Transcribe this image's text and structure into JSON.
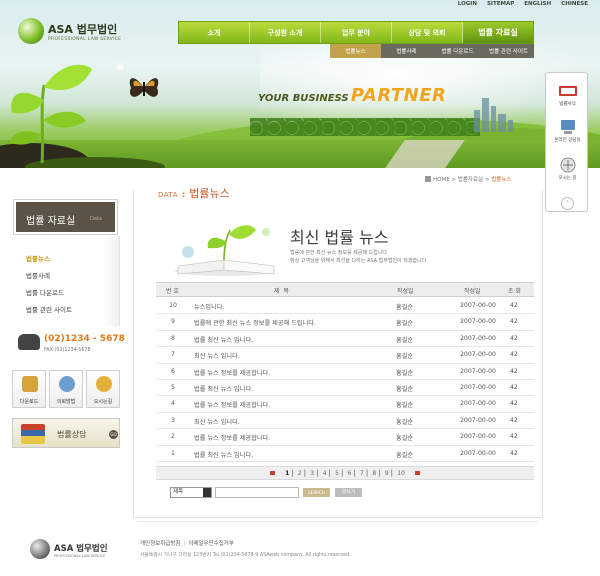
{
  "brand": {
    "name": "ASA 법무법인",
    "tagline": "PROFESSIONAL LAW SERVICE"
  },
  "util_nav": [
    "LOGIN",
    "SITEMAP",
    "ENGLISH",
    "CHINESE"
  ],
  "gnb": [
    "소개",
    "구성원 소개",
    "업무 분야",
    "상담 및 의뢰",
    "법률 자료실"
  ],
  "lnb": [
    "법률뉴스",
    "법률사례",
    "법률 다운로드",
    "법률 관련 사이트"
  ],
  "banner": {
    "slogan_a": "YOUR BUSINESS",
    "slogan_b": "PARTNER"
  },
  "quick_menu": [
    "법률서식",
    "온라인 상담실",
    "오시는 길"
  ],
  "sidebar": {
    "title": "법률 자료실",
    "title_en": "Data",
    "items": [
      "법률뉴스",
      "법률사례",
      "법률 다운로드",
      "법률 관련 사이트"
    ],
    "phone": "(02)1234 - 5678",
    "fax": "FAX:(02)1234-5678",
    "icons": [
      "다운로드",
      "의뢰방법",
      "오시는길"
    ],
    "consult": "법률상담"
  },
  "breadcrumb": [
    "HOME",
    "법률자료실",
    "법률뉴스"
  ],
  "heading": {
    "en": "DATA",
    "sep": ":",
    "ko": "법률뉴스"
  },
  "intro": {
    "title": "최신 법률 뉴스",
    "desc1": "법률에 관한 최신 뉴스 정보를 제공해 드립니다.",
    "desc2": "항상 고객님을 위해서 최선을 다하는 ASA 법무법인이 되겠습니다."
  },
  "table": {
    "headers": [
      "번 호",
      "제            목",
      "작성일",
      "작성일",
      "조 회"
    ],
    "rows": [
      {
        "num": "10",
        "title": "뉴스입니다.",
        "author": "홍길순",
        "date": "2007-00-00",
        "views": "42"
      },
      {
        "num": "9",
        "title": "법률에 관한 최신 뉴스 정보를 제공해 드립니다.",
        "author": "홍길순",
        "date": "2007-00-00",
        "views": "42"
      },
      {
        "num": "8",
        "title": "법률 최신 뉴스 입니다.",
        "author": "홍길순",
        "date": "2007-00-00",
        "views": "42"
      },
      {
        "num": "7",
        "title": "최신 뉴스 입니다.",
        "author": "홍길순",
        "date": "2007-00-00",
        "views": "42"
      },
      {
        "num": "6",
        "title": "법률 뉴스 정보를 제공합니다.",
        "author": "홍길순",
        "date": "2007-00-00",
        "views": "42"
      },
      {
        "num": "5",
        "title": "법률 최신 뉴스 입니다.",
        "author": "홍길순",
        "date": "2007-00-00",
        "views": "42"
      },
      {
        "num": "4",
        "title": "법률 뉴스 정보를 제공합니다.",
        "author": "홍길순",
        "date": "2007-00-00",
        "views": "42"
      },
      {
        "num": "3",
        "title": "최신 뉴스 입니다.",
        "author": "홍길순",
        "date": "2007-00-00",
        "views": "42"
      },
      {
        "num": "2",
        "title": "법률 뉴스 정보를 제공합니다.",
        "author": "홍길순",
        "date": "2007-00-00",
        "views": "42"
      },
      {
        "num": "1",
        "title": "법률 최신 뉴스 입니다.",
        "author": "홍길순",
        "date": "2007-00-00",
        "views": "42"
      }
    ]
  },
  "pager": {
    "pages": [
      "1",
      "2",
      "3",
      "4",
      "5",
      "6",
      "7",
      "8",
      "9",
      "10"
    ],
    "current": "1"
  },
  "search": {
    "select_value": "제목",
    "search_label": "SEARCH",
    "list_label": "글쓰기"
  },
  "footer": {
    "links": [
      "개인정보취급방침",
      "이메일무단수집거부"
    ],
    "address": "서울특별시 가나구 다라동 123번지   Tel.(01)234-5678-9  ASAweb company. All rights reserved."
  },
  "colors": {
    "accent_green": "#83b619",
    "accent_orange": "#e06d2a",
    "sidebar_brown": "#5b5346"
  }
}
